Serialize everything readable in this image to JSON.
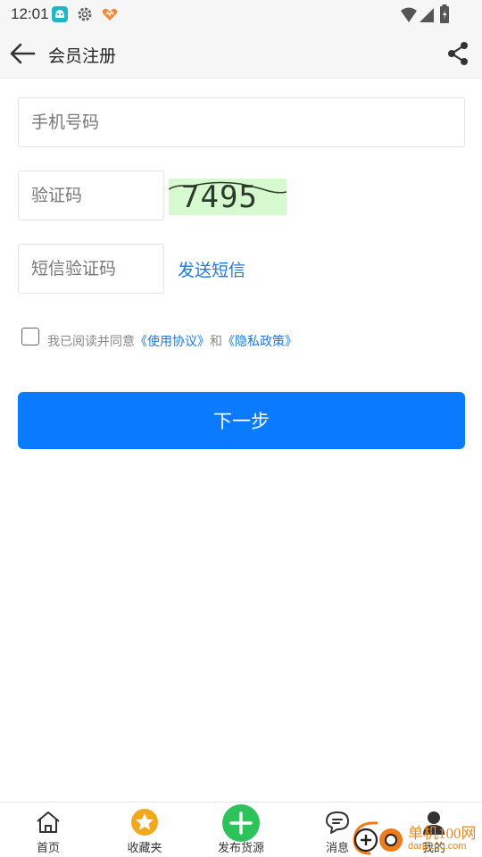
{
  "status_bar": {
    "time": "12:01"
  },
  "header": {
    "title": "会员注册",
    "back_icon": "arrow-left-icon",
    "share_icon": "share-icon"
  },
  "form": {
    "phone_placeholder": "手机号码",
    "captcha_placeholder": "验证码",
    "captcha_code": "7495",
    "sms_placeholder": "短信验证码",
    "send_sms_label": "发送短信",
    "agree_prefix": "我已阅读并同意",
    "agreement_link": "《使用协议》",
    "agree_and": "和",
    "privacy_link": "《隐私政策》",
    "next_label": "下一步"
  },
  "bottom_nav": {
    "items": [
      {
        "label": "首页",
        "icon": "home-icon"
      },
      {
        "label": "收藏夹",
        "icon": "star-icon"
      },
      {
        "label": "发布货源",
        "icon": "plus-icon"
      },
      {
        "label": "消息",
        "icon": "chat-icon"
      },
      {
        "label": "我的",
        "icon": "user-icon"
      }
    ]
  },
  "watermark": {
    "line1": "单机100网",
    "line2": "danji100.com"
  },
  "colors": {
    "accent": "#0a7bff",
    "link": "#1a7ae0",
    "captcha_bg": "#d6f9cf",
    "fav_icon": "#f1a81c",
    "publish_icon": "#2ec25a"
  }
}
